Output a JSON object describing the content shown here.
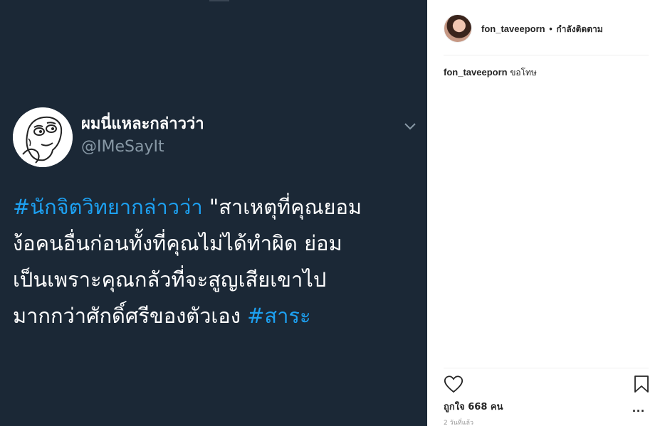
{
  "tweet": {
    "display_name": "ผมนี่แหละกล่าวว่า",
    "handle": "@IMeSayIt",
    "lines": [
      {
        "hashtag": "#นักจิตวิทยากล่าวว่า",
        "text": " \"สาเหตุที่คุณยอม"
      },
      {
        "text": "ง้อคนอื่นก่อนทั้งที่คุณไม่ได้ทำผิด ย่อม"
      },
      {
        "text": "เป็นเพราะคุณกลัวที่จะสูญเสียเขาไป"
      },
      {
        "text": "มากกว่าศักดิ์ศรีของตัวเอง ",
        "hashtag_after": "#สาระ"
      }
    ]
  },
  "post": {
    "username": "fon_taveeporn",
    "dot": "•",
    "follow_status": "กำลังติดตาม",
    "caption_user": "fon_taveeporn",
    "caption_text": "ขอโทษ",
    "likes": "ถูกใจ 668 คน",
    "timestamp": "2 วันที่แล้ว",
    "more_label": "..."
  },
  "icons": {
    "heart": "heart-icon",
    "bookmark": "bookmark-icon",
    "more": "more-options-icon",
    "caret": "chevron-down-icon"
  },
  "colors": {
    "tweet_background": "#1b2836",
    "hashtag": "#1da1f2",
    "handle": "#8899a6"
  }
}
